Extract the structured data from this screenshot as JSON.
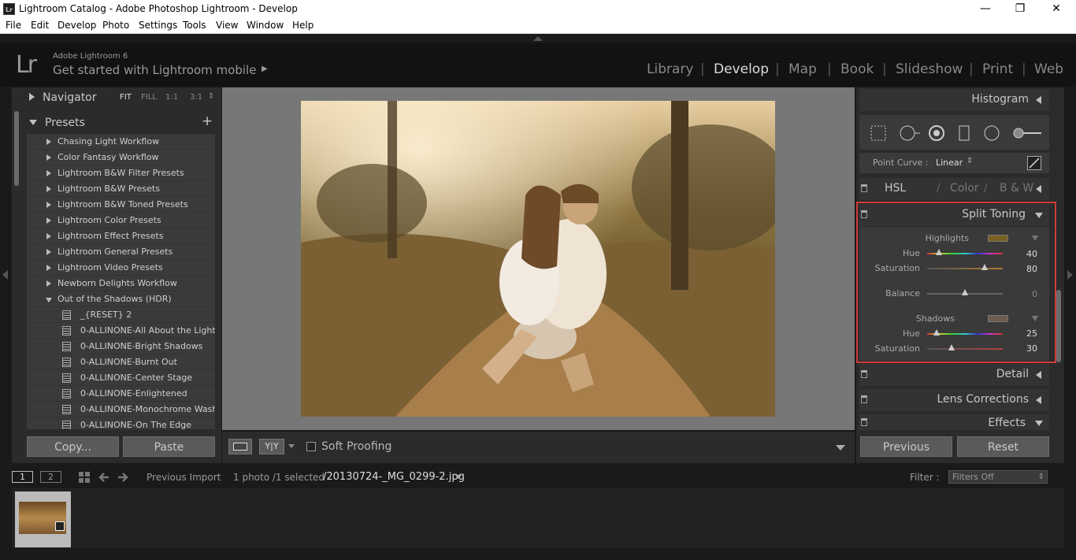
{
  "window": {
    "title": "Lightroom Catalog - Adobe Photoshop Lightroom - Develop",
    "app_icon": "Lr",
    "minimize": "—",
    "restore": "❐",
    "close": "✕"
  },
  "menu": [
    "File",
    "Edit",
    "Develop",
    "Photo",
    "Settings",
    "Tools",
    "View",
    "Window",
    "Help"
  ],
  "identity": {
    "logo": "Lr",
    "product": "Adobe Lightroom 6",
    "tagline": "Get started with Lightroom mobile",
    "tagline_arrow": "▶"
  },
  "modules": [
    {
      "label": "Library",
      "active": false
    },
    {
      "label": "Develop",
      "active": true
    },
    {
      "label": "Map",
      "active": false
    },
    {
      "label": "Book",
      "active": false
    },
    {
      "label": "Slideshow",
      "active": false
    },
    {
      "label": "Print",
      "active": false
    },
    {
      "label": "Web",
      "active": false
    }
  ],
  "navigator": {
    "title": "Navigator",
    "options": [
      "FIT",
      "FILL",
      "1:1",
      "3:1"
    ],
    "active_option": "FIT"
  },
  "presets": {
    "title": "Presets",
    "add": "+",
    "folders": [
      "Chasing Light Workflow",
      "Color Fantasy Workflow",
      "Lightroom B&W Filter Presets",
      "Lightroom B&W Presets",
      "Lightroom B&W Toned Presets",
      "Lightroom Color Presets",
      "Lightroom Effect Presets",
      "Lightroom General Presets",
      "Lightroom Video Presets",
      "Newborn Delights Workflow"
    ],
    "open_folder": "Out of the Shadows (HDR)",
    "items": [
      "_{RESET} 2",
      "0-ALLINONE-All About the Light",
      "0-ALLINONE-Bright Shadows",
      "0-ALLINONE-Burnt Out",
      "0-ALLINONE-Center Stage",
      "0-ALLINONE-Enlightened",
      "0-ALLINONE-Monochrome Wash",
      "0-ALLINONE-On The Edge"
    ]
  },
  "left_buttons": {
    "copy": "Copy...",
    "paste": "Paste"
  },
  "toolbar": {
    "soft_proofing": "Soft Proofing",
    "compare": "Y|Y"
  },
  "right_panel": {
    "histogram": "Histogram",
    "point_curve_label": "Point Curve :",
    "point_curve_value": "Linear",
    "hsl_tabs": [
      "HSL",
      "Color",
      "B & W"
    ],
    "split_toning": {
      "title": "Split Toning",
      "highlights_label": "Highlights",
      "highlights_color": "#7a5f22",
      "highlights_hue_label": "Hue",
      "highlights_hue": "40",
      "highlights_sat_label": "Saturation",
      "highlights_sat": "80",
      "balance_label": "Balance",
      "balance": "0",
      "shadows_label": "Shadows",
      "shadows_color": "#6e5c50",
      "shadows_hue_label": "Hue",
      "shadows_hue": "25",
      "shadows_sat_label": "Saturation",
      "shadows_sat": "30"
    },
    "detail": "Detail",
    "lens_corrections": "Lens Corrections",
    "effects": "Effects",
    "previous": "Previous",
    "reset": "Reset"
  },
  "filmstrip": {
    "screen1": "1",
    "screen2": "2",
    "source": "Previous Import",
    "count": "1 photo /1 selected",
    "filename": "/20130724-_MG_0299-2.jpg",
    "filter_label": "Filter :",
    "filter_value": "Filters Off"
  },
  "colors": {
    "accent_highlight": "#d03b3b",
    "panel_bg": "#2b2b2b",
    "canvas_bg": "#777777"
  }
}
